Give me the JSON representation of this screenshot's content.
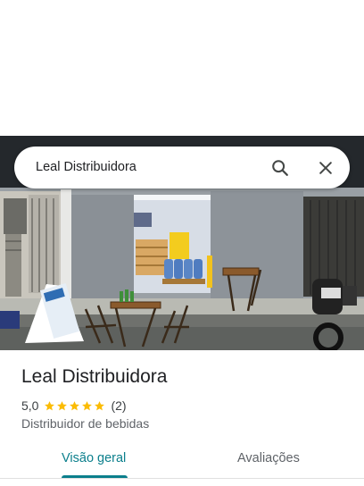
{
  "search": {
    "query": "Leal Distribuidora"
  },
  "place": {
    "name": "Leal Distribuidora",
    "rating": "5,0",
    "review_count": "(2)",
    "stars": 5,
    "category": "Distribuidor de bebidas"
  },
  "tabs": [
    {
      "label": "Visão geral",
      "active": true
    },
    {
      "label": "Avaliações",
      "active": false
    }
  ],
  "colors": {
    "accent": "#0b7f8c",
    "star": "#fbbc04"
  },
  "icons": {
    "search": "search-icon",
    "close": "close-icon"
  }
}
